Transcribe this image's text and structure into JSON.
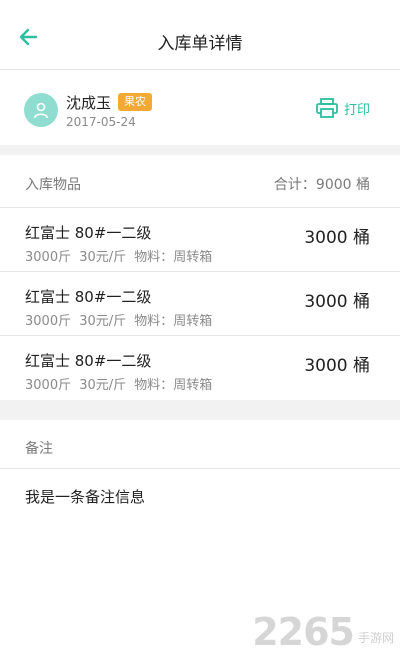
{
  "header": {
    "title": "入库单详情",
    "back_icon": "arrow-left-icon"
  },
  "user": {
    "name": "沈成玉",
    "badge": "果农",
    "date": "2017-05-24",
    "print_label": "打印"
  },
  "colors": {
    "accent": "#2bbf9f",
    "badge": "#f3a934",
    "avatar_bg": "#8fdcd0"
  },
  "goods": {
    "label": "入库物品",
    "total": "合计：9000 桶",
    "items": [
      {
        "name": "红富士 80#一二级",
        "meta": "3000斤  30元/斤  物料：周转箱",
        "qty": "3000 桶"
      },
      {
        "name": "红富士 80#一二级",
        "meta": "3000斤  30元/斤  物料：周转箱",
        "qty": "3000 桶"
      },
      {
        "name": "红富士 80#一二级",
        "meta": "3000斤  30元/斤  物料：周转箱",
        "qty": "3000 桶"
      }
    ]
  },
  "note": {
    "label": "备注",
    "text": "我是一条备注信息"
  },
  "watermark": {
    "number": "2265",
    "suffix": "手游网"
  }
}
